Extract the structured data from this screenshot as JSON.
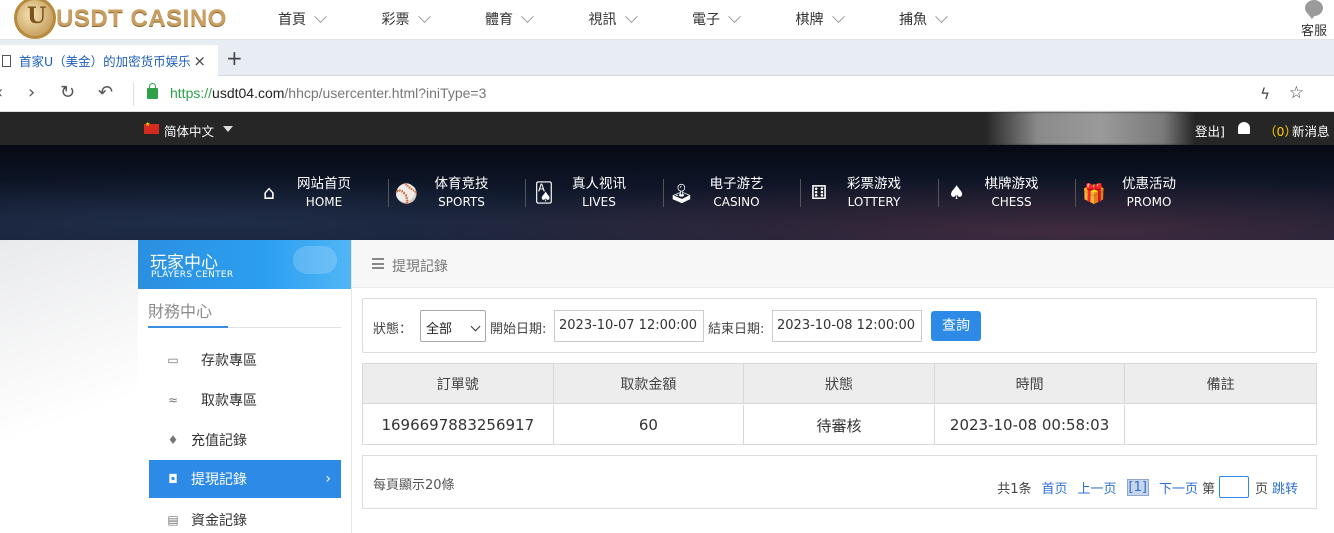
{
  "site": {
    "logo_text": "USDT CASINO",
    "nav": [
      "首頁",
      "彩票",
      "體育",
      "視訊",
      "電子",
      "棋牌",
      "捕魚"
    ],
    "support_label": "客服"
  },
  "browser": {
    "tab_title": "首家U（美金）的加密货币娱乐",
    "tab_close": "×",
    "new_tab": "+",
    "url_scheme": "https://",
    "url_host": "usdt04.com",
    "url_path": "/hhcp/usercenter.html?iniType=3"
  },
  "topbar": {
    "language": "简体中文",
    "logout_fragment": "登出]",
    "message_count": "（0）",
    "message_label": "新消息"
  },
  "mainnav": [
    {
      "zh": "网站首页",
      "en": "HOME",
      "icon": "home-icon",
      "glyph": "⌂"
    },
    {
      "zh": "体育竞技",
      "en": "SPORTS",
      "icon": "ball-icon",
      "glyph": "⚾"
    },
    {
      "zh": "真人视讯",
      "en": "LIVES",
      "icon": "cards-icon",
      "glyph": "🂡"
    },
    {
      "zh": "电子游艺",
      "en": "CASINO",
      "icon": "joystick-icon",
      "glyph": "🕹"
    },
    {
      "zh": "彩票游戏",
      "en": "LOTTERY",
      "icon": "dice-icon",
      "glyph": "⚅"
    },
    {
      "zh": "棋牌游戏",
      "en": "CHESS",
      "icon": "spade-icon",
      "glyph": "♠"
    },
    {
      "zh": "优惠活动",
      "en": "PROMO",
      "icon": "gift-icon",
      "glyph": "🎁"
    }
  ],
  "sidebar": {
    "title_zh": "玩家中心",
    "title_en": "PLAYERS CENTER",
    "section": "財務中心",
    "items": [
      {
        "label": "存款專區",
        "icon": "deposit-icon",
        "glyph": "▭"
      },
      {
        "label": "取款專區",
        "icon": "withdraw-icon",
        "glyph": "≈"
      },
      {
        "label": "充值記錄",
        "icon": "moneybag-icon",
        "glyph": "♦"
      },
      {
        "label": "提現記錄",
        "icon": "wallet-icon",
        "glyph": "◘",
        "active": true
      },
      {
        "label": "資金記錄",
        "icon": "funds-icon",
        "glyph": "▤"
      }
    ],
    "active_arrow": "›"
  },
  "content": {
    "title": "提現記錄",
    "filter": {
      "status_label": "狀態：",
      "status_value": "全部",
      "start_label": "開始日期:",
      "start_value": "2023-10-07 12:00:00",
      "end_label": "結束日期:",
      "end_value": "2023-10-08 12:00:00",
      "query_button": "查詢"
    },
    "table": {
      "headers": [
        "訂單號",
        "取款金額",
        "狀態",
        "時間",
        "備註"
      ],
      "rows": [
        [
          "1696697883256917",
          "60",
          "待審核",
          "2023-10-08 00:58:03",
          ""
        ]
      ]
    },
    "pager": {
      "per_page": "每頁顯示20條",
      "total": "共1条",
      "first": "首页",
      "prev": "上一页",
      "current": "[1]",
      "next": "下一页",
      "page_label": "第",
      "page_suffix": "页",
      "go": "跳转"
    }
  },
  "colors": {
    "accent": "#2d8ae6",
    "link": "#2d6fd0",
    "message_count": "#ffcc00",
    "logo_gold": "#c9a062"
  }
}
